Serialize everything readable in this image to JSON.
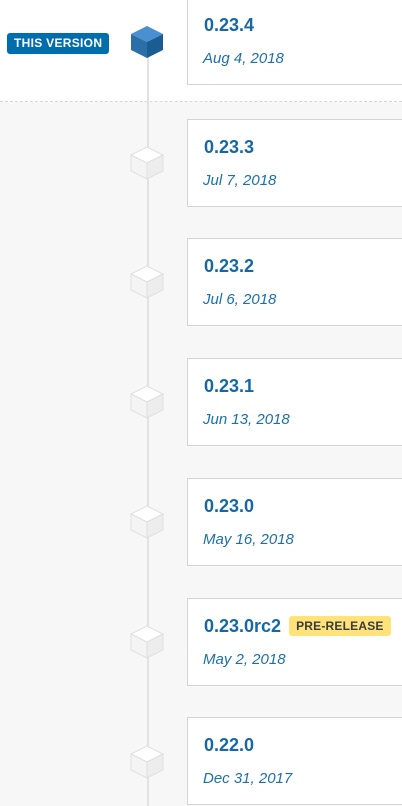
{
  "current_badge": "THIS VERSION",
  "versions": [
    {
      "version": "0.23.4",
      "date": "Aug 4, 2018"
    },
    {
      "version": "0.23.3",
      "date": "Jul 7, 2018"
    },
    {
      "version": "0.23.2",
      "date": "Jul 6, 2018"
    },
    {
      "version": "0.23.1",
      "date": "Jun 13, 2018"
    },
    {
      "version": "0.23.0",
      "date": "May 16, 2018"
    },
    {
      "version": "0.23.0rc2",
      "date": "May 2, 2018",
      "badge": "PRE-RELEASE"
    },
    {
      "version": "0.22.0",
      "date": "Dec 31, 2017"
    }
  ],
  "colors": {
    "accent": "#006dad",
    "version_text": "#1568a8",
    "prerelease_badge": "#ffe27a",
    "current_cube": "#2a6fa8"
  }
}
